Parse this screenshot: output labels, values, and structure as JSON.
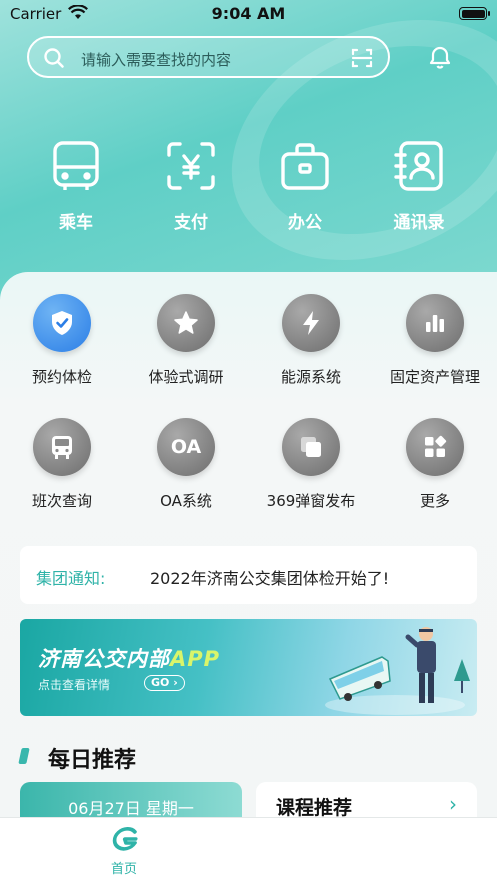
{
  "status_bar": {
    "carrier": "Carrier",
    "time": "9:04 AM"
  },
  "search": {
    "placeholder": "请输入需要查找的内容"
  },
  "quick_actions": [
    {
      "label": "乘车",
      "icon": "bus-icon"
    },
    {
      "label": "支付",
      "icon": "yuan-scan-icon"
    },
    {
      "label": "办公",
      "icon": "briefcase-icon"
    },
    {
      "label": "通讯录",
      "icon": "contacts-icon"
    }
  ],
  "functions": [
    {
      "label": "预约体检",
      "icon": "shield-check-icon",
      "active": true
    },
    {
      "label": "体验式调研",
      "icon": "star-icon"
    },
    {
      "label": "能源系统",
      "icon": "lightning-icon"
    },
    {
      "label": "固定资产管理",
      "icon": "bar-chart-icon"
    },
    {
      "label": "班次查询",
      "icon": "bus-icon"
    },
    {
      "label": "OA系统",
      "icon": "oa-icon",
      "glyph": "OA"
    },
    {
      "label": "369弹窗发布",
      "icon": "layers-icon"
    },
    {
      "label": "更多",
      "icon": "grid-icon"
    }
  ],
  "notice": {
    "label": "集团通知:",
    "text": "2022年济南公交集团体检开始了!"
  },
  "banner": {
    "title_main": "济南公交内部",
    "title_accent": "APP",
    "subtitle": "点击查看详情",
    "go": "GO"
  },
  "daily": {
    "title": "每日推荐",
    "date": "06月27日 星期一",
    "course_title": "课程推荐",
    "course_arrow": "›"
  },
  "tabbar": {
    "home_label": "首页"
  },
  "colors": {
    "accent": "#2fb3a8",
    "hero": "#5fcfc6",
    "active_icon": "#2b7ee6"
  }
}
